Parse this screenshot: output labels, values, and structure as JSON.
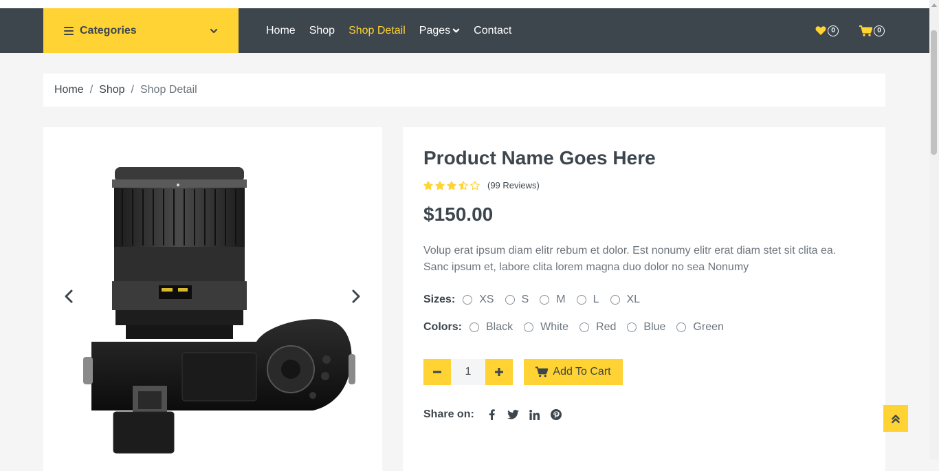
{
  "header": {
    "categories_label": "Categories",
    "nav": [
      {
        "label": "Home"
      },
      {
        "label": "Shop"
      },
      {
        "label": "Shop Detail"
      },
      {
        "label": "Pages"
      },
      {
        "label": "Contact"
      }
    ],
    "wishlist_count": "0",
    "cart_count": "0"
  },
  "breadcrumb": {
    "items": [
      "Home",
      "Shop",
      "Shop Detail"
    ],
    "separator": "/"
  },
  "product": {
    "name": "Product Name Goes Here",
    "rating": 3.5,
    "rating_max": 5,
    "reviews": "(99 Reviews)",
    "price": "$150.00",
    "description": "Volup erat ipsum diam elitr rebum et dolor. Est nonumy elitr erat diam stet sit clita ea. Sanc ipsum et, labore clita lorem magna duo dolor no sea Nonumy",
    "sizes_label": "Sizes:",
    "sizes": [
      "XS",
      "S",
      "M",
      "L",
      "XL"
    ],
    "colors_label": "Colors:",
    "colors": [
      "Black",
      "White",
      "Red",
      "Blue",
      "Green"
    ],
    "quantity": "1",
    "add_to_cart": "Add To Cart",
    "share_label": "Share on:",
    "share_icons": [
      "facebook-icon",
      "twitter-icon",
      "linkedin-icon",
      "pinterest-icon"
    ]
  },
  "colors": {
    "accent": "#ffd333",
    "dark": "#3d464d",
    "muted": "#6c757d",
    "background": "#f5f5f5"
  }
}
